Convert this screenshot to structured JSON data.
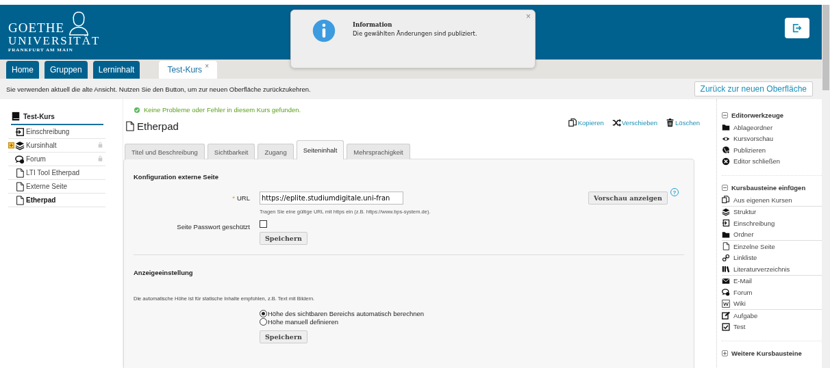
{
  "header": {
    "logo": {
      "line1": "GOETHE",
      "line2": "UNIVERSITÄT",
      "line3": "FRANKFURT AM MAIN"
    }
  },
  "main_tabs": [
    {
      "label": "Home",
      "selected": false
    },
    {
      "label": "Gruppen",
      "selected": false
    },
    {
      "label": "Lerninhalt",
      "selected": false
    },
    {
      "label": "Test-Kurs",
      "selected": true,
      "close": "×"
    }
  ],
  "notice": {
    "text": "Sie verwenden aktuell die alte Ansicht. Nutzen Sie den Button, um zur neuen Oberfläche zurückzukehren.",
    "button": "Zurück zur neuen Oberfläche"
  },
  "popup": {
    "title": "Information",
    "message": "Die gewählten Änderungen sind publiziert.",
    "close": "×"
  },
  "course_tree": {
    "title": "Test-Kurs",
    "children": [
      {
        "label": "Einschreibung",
        "kind": "enroll",
        "selected": false
      },
      {
        "label": "Kursinhalt",
        "kind": "structure",
        "selected": false,
        "locked": true,
        "expanded": false
      },
      {
        "label": "Forum",
        "kind": "forum",
        "selected": false,
        "locked": true
      },
      {
        "label": "LTI Tool Etherpad",
        "kind": "page",
        "selected": false
      },
      {
        "label": "Externe Seite",
        "kind": "page",
        "selected": false
      },
      {
        "label": "Etherpad",
        "kind": "page",
        "selected": true
      }
    ]
  },
  "status": "Keine Probleme oder Fehler in diesem Kurs gefunden.",
  "node_title": "Etherpad",
  "actions": [
    {
      "label": "Kopieren",
      "kind": "copy"
    },
    {
      "label": "Verschieben",
      "kind": "move"
    },
    {
      "label": "Löschen",
      "kind": "trash"
    }
  ],
  "tabs": [
    {
      "label": "Titel und Beschreibung",
      "selected": false
    },
    {
      "label": "Sichtbarkeit",
      "selected": false
    },
    {
      "label": "Zugang",
      "selected": false
    },
    {
      "label": "Seiteninhalt",
      "selected": true
    },
    {
      "label": "Mehrsprachigkeit",
      "selected": false
    }
  ],
  "config": {
    "heading": "Konfiguration externe Seite",
    "required_mark": "*",
    "url_label": "URL",
    "url_value": "https://eplite.studiumdigitale.uni-fran",
    "url_hint": "Tragen Sie eine gültige URL mit https ein (z.B. https://www.bps-system.de).",
    "preview_button": "Vorschau anzeigen",
    "help": "?",
    "password_label": "Seite Passwort geschützt",
    "password_checked": false,
    "save": "Speichern"
  },
  "display": {
    "heading": "Anzeigeeinstellung",
    "description": "Die automatische Höhe ist für statische Inhalte empfohlen, z.B. Text mit Bildern.",
    "options": [
      {
        "label": "Höhe des sichtbaren Bereichs automatisch berechnen",
        "selected": true
      },
      {
        "label": "Höhe manuell definieren",
        "selected": false
      }
    ],
    "save": "Speichern"
  },
  "toolbox": [
    {
      "title": "Editorwerkzeuge",
      "expanded": true,
      "groups": [
        [
          {
            "label": "Ablageordner",
            "kind": "folder"
          },
          {
            "label": "Kursvorschau",
            "kind": "eye"
          },
          {
            "label": "Publizieren",
            "kind": "globe"
          },
          {
            "label": "Editor schließen",
            "kind": "xcircle"
          }
        ]
      ]
    },
    {
      "title": "Kursbausteine einfügen",
      "expanded": true,
      "groups": [
        [
          {
            "label": "Aus eigenen Kursen",
            "kind": "copy"
          }
        ],
        [
          {
            "label": "Struktur",
            "kind": "structure"
          },
          {
            "label": "Einschreibung",
            "kind": "enroll"
          },
          {
            "label": "Ordner",
            "kind": "folder"
          }
        ],
        [
          {
            "label": "Einzelne Seite",
            "kind": "page"
          },
          {
            "label": "Linkliste",
            "kind": "link"
          },
          {
            "label": "Literaturverzeichnis",
            "kind": "books"
          }
        ],
        [
          {
            "label": "E-Mail",
            "kind": "mail"
          },
          {
            "label": "Forum",
            "kind": "forum"
          },
          {
            "label": "Wiki",
            "kind": "wiki"
          }
        ],
        [
          {
            "label": "Aufgabe",
            "kind": "edit"
          },
          {
            "label": "Test",
            "kind": "check"
          }
        ]
      ]
    },
    {
      "title": "Weitere Kursbausteine",
      "expanded": false
    }
  ]
}
